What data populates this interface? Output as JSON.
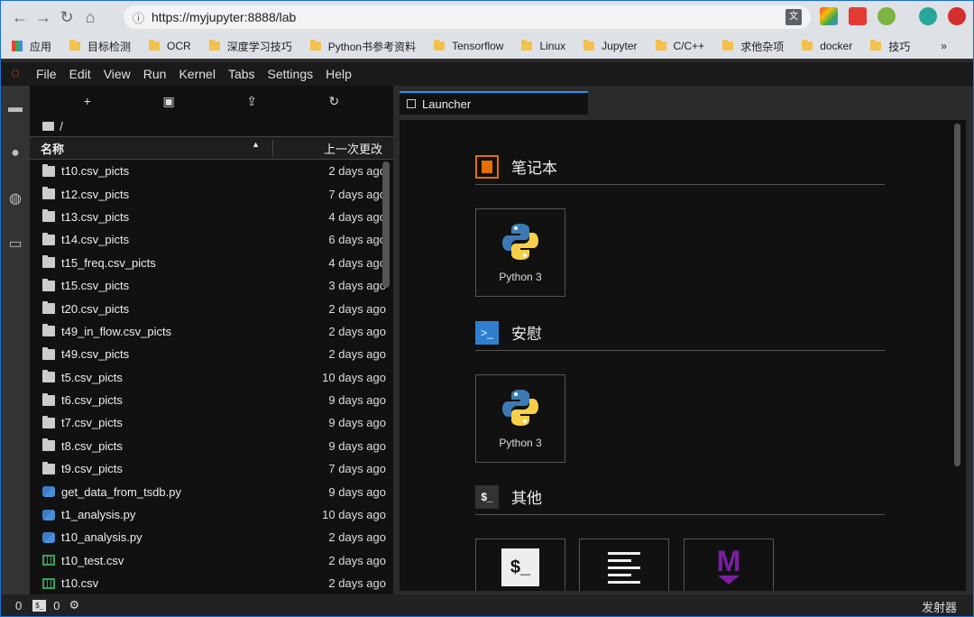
{
  "browser": {
    "url": "https://myjupyter:8888/lab",
    "bookmarks": [
      "应用",
      "目标检测",
      "OCR",
      "深度学习技巧",
      "Python书参考资料",
      "Tensorflow",
      "Linux",
      "Jupyter",
      "C/C++",
      "求他杂项",
      "docker",
      "技巧"
    ],
    "overflow": "»"
  },
  "menu": [
    "File",
    "Edit",
    "View",
    "Run",
    "Kernel",
    "Tabs",
    "Settings",
    "Help"
  ],
  "filebrowser": {
    "path": "/",
    "col_name": "名称",
    "col_modified": "上一次更改",
    "sort_indicator": "▲",
    "files": [
      {
        "name": "t10.csv_picts",
        "modified": "2 days ago",
        "type": "folder"
      },
      {
        "name": "t12.csv_picts",
        "modified": "7 days ago",
        "type": "folder"
      },
      {
        "name": "t13.csv_picts",
        "modified": "4 days ago",
        "type": "folder"
      },
      {
        "name": "t14.csv_picts",
        "modified": "6 days ago",
        "type": "folder"
      },
      {
        "name": "t15_freq.csv_picts",
        "modified": "4 days ago",
        "type": "folder"
      },
      {
        "name": "t15.csv_picts",
        "modified": "3 days ago",
        "type": "folder"
      },
      {
        "name": "t20.csv_picts",
        "modified": "2 days ago",
        "type": "folder"
      },
      {
        "name": "t49_in_flow.csv_picts",
        "modified": "2 days ago",
        "type": "folder"
      },
      {
        "name": "t49.csv_picts",
        "modified": "2 days ago",
        "type": "folder"
      },
      {
        "name": "t5.csv_picts",
        "modified": "10 days ago",
        "type": "folder"
      },
      {
        "name": "t6.csv_picts",
        "modified": "9 days ago",
        "type": "folder"
      },
      {
        "name": "t7.csv_picts",
        "modified": "9 days ago",
        "type": "folder"
      },
      {
        "name": "t8.csv_picts",
        "modified": "9 days ago",
        "type": "folder"
      },
      {
        "name": "t9.csv_picts",
        "modified": "7 days ago",
        "type": "folder"
      },
      {
        "name": "get_data_from_tsdb.py",
        "modified": "9 days ago",
        "type": "python"
      },
      {
        "name": "t1_analysis.py",
        "modified": "10 days ago",
        "type": "python"
      },
      {
        "name": "t10_analysis.py",
        "modified": "2 days ago",
        "type": "python"
      },
      {
        "name": "t10_test.csv",
        "modified": "2 days ago",
        "type": "csv"
      },
      {
        "name": "t10.csv",
        "modified": "2 days ago",
        "type": "csv"
      }
    ]
  },
  "tab": {
    "label": "Launcher"
  },
  "launcher": {
    "notebook_title": "笔记本",
    "console_title": "安慰",
    "other_title": "其他",
    "kernel_label": "Python 3",
    "console_kernel_label": "Python 3",
    "terminal_glyph": "$_",
    "markdown_glyph": "M"
  },
  "statusbar": {
    "count_left": "0",
    "count_right": "0",
    "right_label": "发射器"
  }
}
